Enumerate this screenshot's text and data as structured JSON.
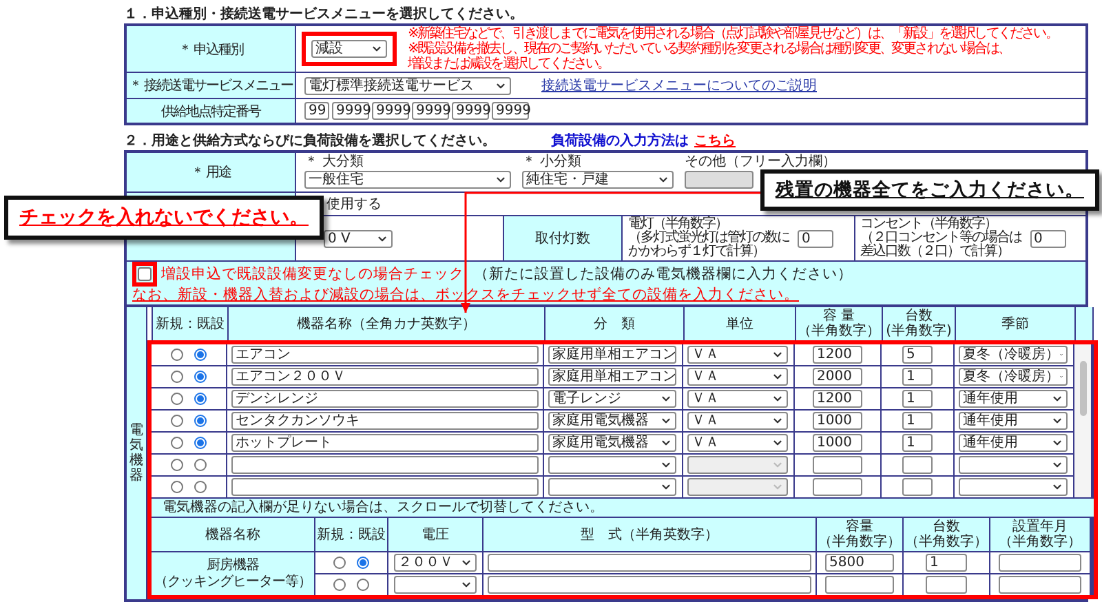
{
  "section1": {
    "heading": "１．申込種別・接続送電サービスメニューを選択してください。",
    "application_type": {
      "label": "＊ 申込種別",
      "value": "減設",
      "highlighted": true
    },
    "notes": [
      "※新築住宅などで、引き渡しまでに電気を使用される場合（点灯試験や部屋見せなど）は、「新設」を選択してください。",
      "※既設設備を撤去し、現在のご契約いただいている契約種別を変更される場合は種別変更、変更されない場合は、",
      "増設または減設を選択してください。"
    ],
    "service_menu": {
      "label": "＊ 接続送電サービスメニュー",
      "value": "電灯標準接続送電サービス",
      "link": "接続送電サービスメニューについてのご説明"
    },
    "supply_point": {
      "label": "供給地点特定番号",
      "values": [
        "99",
        "9999",
        "9999",
        "9999",
        "9999",
        "9999"
      ]
    }
  },
  "section2": {
    "heading": "２．用途と供給方式ならびに負荷設備を選択してください。",
    "help_text": "負荷設備の入力方法は",
    "help_link": "こちら",
    "usage": {
      "label": "＊ 用途",
      "major": {
        "label": "＊ 大分類",
        "value": "一般住宅"
      },
      "minor": {
        "label": "＊ 小分類",
        "value": "純住宅・戸建"
      },
      "other": {
        "label": "その他（フリー入力欄）",
        "disabled": true
      }
    },
    "usage_note": "使用する",
    "voltage": {
      "value": "0 V"
    },
    "lights": {
      "label": "取付灯数",
      "lamp": {
        "lines": [
          "電灯（半角数字）",
          "（多灯式蛍光灯は管灯の数に",
          "かかわらず１灯で計算）"
        ],
        "value": "0"
      },
      "outlet": {
        "lines": [
          "コンセント（半角数字）",
          "（２口コンセント等の場合は",
          "差込口数（２口）で計算）"
        ],
        "value": "0"
      }
    },
    "no_change_check": {
      "checked": false,
      "highlighted": true,
      "label": "増設申込で既設設備変更なしの場合チェック",
      "label_note": "（新たに設置した設備のみ電気機器欄に入力ください）",
      "note": "なお、新設・機器入替および減設の場合は、ボックスをチェックせず全ての設備を入力ください。"
    }
  },
  "appliances": {
    "side_label": "電気機器",
    "highlighted": true,
    "columns": [
      {
        "label": "新規：既設"
      },
      {
        "label": "機器名称（全角カナ英数字）"
      },
      {
        "label": "分　類"
      },
      {
        "label": "単位"
      },
      {
        "label": "容 量",
        "sub": "（半角数字）"
      },
      {
        "label": "台数",
        "sub": "(半角数字)"
      },
      {
        "label": "季節"
      }
    ],
    "rows": [
      {
        "new_selected": false,
        "existing_selected": true,
        "name": "エアコン",
        "category": "家庭用単相エアコン",
        "unit": "ＶＡ",
        "unit_disabled": false,
        "capacity": "1200",
        "count": "5",
        "season": "夏冬（冷暖房）"
      },
      {
        "new_selected": false,
        "existing_selected": true,
        "name": "エアコン２００Ｖ",
        "category": "家庭用単相エアコン",
        "unit": "ＶＡ",
        "unit_disabled": false,
        "capacity": "2000",
        "count": "1",
        "season": "夏冬（冷暖房）"
      },
      {
        "new_selected": false,
        "existing_selected": true,
        "name": "デンシレンジ",
        "category": "電子レンジ",
        "unit": "ＶＡ",
        "unit_disabled": false,
        "capacity": "1200",
        "count": "1",
        "season": "通年使用"
      },
      {
        "new_selected": false,
        "existing_selected": true,
        "name": "センタクカンソウキ",
        "category": "家庭用電気機器",
        "unit": "ＶＡ",
        "unit_disabled": false,
        "capacity": "1000",
        "count": "1",
        "season": "通年使用"
      },
      {
        "new_selected": false,
        "existing_selected": true,
        "name": "ホットプレート",
        "category": "家庭用電気機器",
        "unit": "ＶＡ",
        "unit_disabled": false,
        "capacity": "1000",
        "count": "1",
        "season": "通年使用"
      },
      {
        "new_selected": false,
        "existing_selected": false,
        "unit_disabled": true
      },
      {
        "new_selected": false,
        "existing_selected": false,
        "unit_disabled": true
      }
    ],
    "scroll_note": "電気機器の記入欄が足りない場合は、スクロールで切替してください。",
    "cooking": {
      "columns": [
        {
          "label": "機器名称"
        },
        {
          "label": "新規：既設"
        },
        {
          "label": "電圧"
        },
        {
          "label": "型　式（半角英数字）"
        },
        {
          "label": "容量",
          "sub": "（半角数字）"
        },
        {
          "label": "台数",
          "sub": "（半角数字）"
        },
        {
          "label": "設置年月",
          "sub": "（半角数字）"
        }
      ],
      "name": "厨房機器",
      "name_note": "（クッキングヒーター等）",
      "rows": [
        {
          "new_selected": false,
          "existing_selected": true,
          "voltage": "２００Ｖ",
          "capacity": "5800",
          "count": "1"
        },
        {
          "new_selected": false,
          "existing_selected": false
        }
      ]
    }
  },
  "callouts": [
    "チェックを入れないでください。",
    "残置の機器全てをご入力ください。"
  ]
}
